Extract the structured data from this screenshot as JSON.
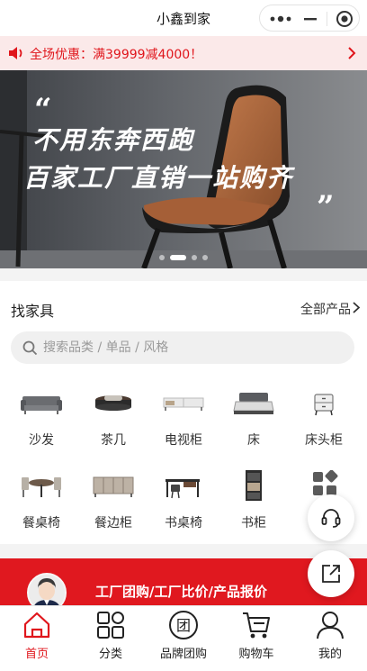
{
  "titlebar": {
    "title": "小鑫到家"
  },
  "promo": {
    "text": "全场优惠：满39999减4000！"
  },
  "banner": {
    "line1": "不用东奔西跑",
    "line2": "百家工厂直销一站购齐",
    "slides": 4,
    "active_slide": 2
  },
  "find": {
    "title": "找家具",
    "all_label": "全部产品",
    "search_placeholder": "搜索品类 / 单品 / 风格"
  },
  "categories": [
    {
      "label": "沙发",
      "icon": "sofa-icon"
    },
    {
      "label": "茶几",
      "icon": "coffee-table-icon"
    },
    {
      "label": "电视柜",
      "icon": "tv-cabinet-icon"
    },
    {
      "label": "床",
      "icon": "bed-icon"
    },
    {
      "label": "床头柜",
      "icon": "nightstand-icon"
    },
    {
      "label": "餐桌椅",
      "icon": "dining-set-icon"
    },
    {
      "label": "餐边柜",
      "icon": "sideboard-icon"
    },
    {
      "label": "书桌椅",
      "icon": "desk-icon"
    },
    {
      "label": "书柜",
      "icon": "bookcase-icon"
    },
    {
      "label": "",
      "icon": "more-category-icon"
    }
  ],
  "redband": {
    "slogan": "工厂团购/工厂比价/产品报价"
  },
  "tabs": [
    {
      "label": "首页",
      "icon": "home-icon",
      "active": true
    },
    {
      "label": "分类",
      "icon": "category-icon",
      "active": false
    },
    {
      "label": "品牌团购",
      "icon": "group-buy-icon",
      "active": false
    },
    {
      "label": "购物车",
      "icon": "cart-icon",
      "active": false
    },
    {
      "label": "我的",
      "icon": "user-icon",
      "active": false
    }
  ],
  "colors": {
    "accent": "#e0161c",
    "promo_bg": "#fbe9e9",
    "band": "#e0181f"
  }
}
